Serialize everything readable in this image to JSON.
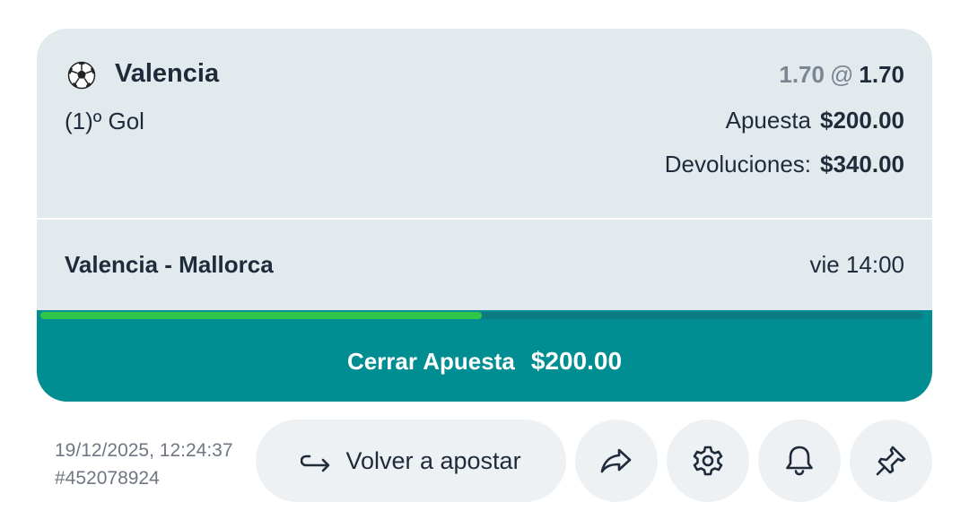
{
  "bet": {
    "selection": "Valencia",
    "market": "(1)º Gol",
    "odds_original": "1.70",
    "odds_at": "@",
    "odds_current": "1.70",
    "stake_label": "Apuesta",
    "stake_value": "$200.00",
    "returns_label": "Devoluciones:",
    "returns_value": "$340.00",
    "event": "Valencia - Mallorca",
    "event_time": "vie 14:00"
  },
  "cashout": {
    "label": "Cerrar Apuesta",
    "amount": "$200.00",
    "progress_fraction": 0.5
  },
  "footer": {
    "timestamp": "19/12/2025, 12:24:37",
    "bet_id": "#452078924",
    "rebet_label": "Volver a apostar"
  },
  "icons": {
    "sport": "soccer-ball-icon",
    "rebet": "return-arrow-icon",
    "share": "share-arrow-icon",
    "settings": "gear-icon",
    "notify": "bell-icon",
    "pin": "pin-icon"
  },
  "colors": {
    "card_bg": "#e3eaee",
    "cashout_bg": "#008e92",
    "progress_fill": "#2fc64a",
    "button_bg": "#eef1f3"
  }
}
